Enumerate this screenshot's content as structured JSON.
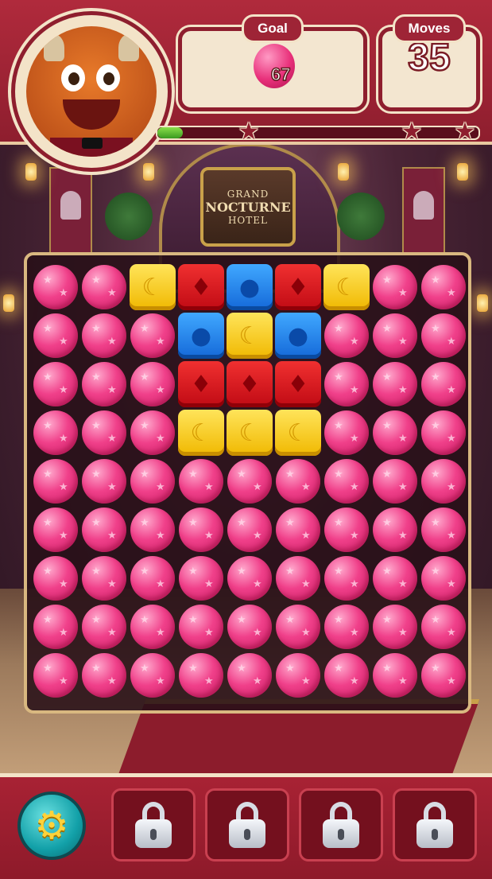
{
  "scene": {
    "sign_line1": "GRAND",
    "sign_line2": "NOCTURNE",
    "sign_line3": "HOTEL"
  },
  "hud": {
    "goal_label": "Goal",
    "goal_item": "pink-balloon",
    "goal_count": "67",
    "moves_label": "Moves",
    "moves_count": "35",
    "progress_fraction": 0.08,
    "stars": 3
  },
  "board": {
    "columns": 9,
    "rows": 9,
    "grid": [
      [
        "B",
        "B",
        "Y",
        "R",
        "U",
        "R",
        "Y",
        "B",
        "B"
      ],
      [
        "B",
        "B",
        "B",
        "U",
        "Y",
        "U",
        "B",
        "B",
        "B"
      ],
      [
        "B",
        "B",
        "B",
        "R",
        "R",
        "R",
        "B",
        "B",
        "B"
      ],
      [
        "B",
        "B",
        "B",
        "Y",
        "Y",
        "Y",
        "B",
        "B",
        "B"
      ],
      [
        "B",
        "B",
        "B",
        "B",
        "B",
        "B",
        "B",
        "B",
        "B"
      ],
      [
        "B",
        "B",
        "B",
        "B",
        "B",
        "B",
        "B",
        "B",
        "B"
      ],
      [
        "B",
        "B",
        "B",
        "B",
        "B",
        "B",
        "B",
        "B",
        "B"
      ],
      [
        "B",
        "B",
        "B",
        "B",
        "B",
        "B",
        "B",
        "B",
        "B"
      ],
      [
        "B",
        "B",
        "B",
        "B",
        "B",
        "B",
        "B",
        "B",
        "B"
      ]
    ],
    "legend": {
      "B": "pink-balloon",
      "Y": "yellow-moon-block",
      "R": "red-bat-block",
      "U": "blue-drop-block"
    },
    "colors": {
      "yellow": "#f0b800",
      "red": "#c00a14",
      "blue": "#1468d8",
      "pink": "#f0408a"
    }
  },
  "bottom_bar": {
    "settings_icon": "gear-icon",
    "booster_slots": [
      "lock-icon",
      "lock-icon",
      "lock-icon",
      "lock-icon"
    ]
  }
}
